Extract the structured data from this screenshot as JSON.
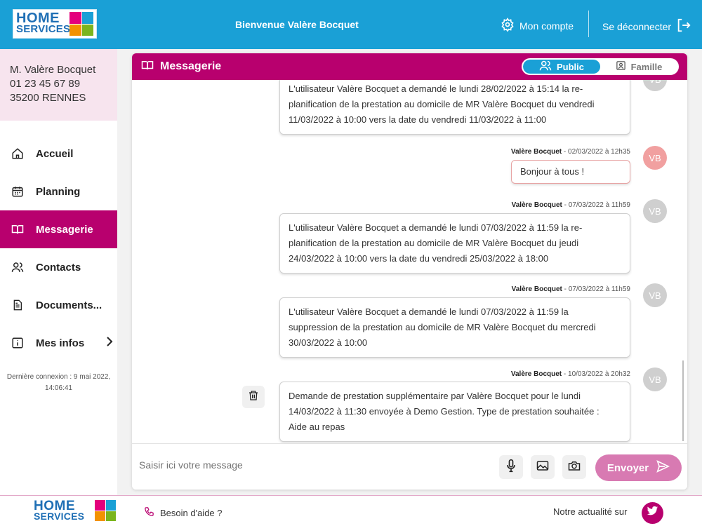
{
  "header": {
    "logo_line1": "HOME",
    "logo_line2": "SERVICES",
    "welcome": "Bienvenue Valère Bocquet",
    "account_label": "Mon compte",
    "logout_label": "Se déconnecter"
  },
  "sidebar": {
    "user": {
      "name": "M. Valère Bocquet",
      "phone": "01 23 45 67 89",
      "city": "35200 RENNES"
    },
    "items": [
      {
        "label": "Accueil",
        "icon": "home-icon"
      },
      {
        "label": "Planning",
        "icon": "calendar-icon"
      },
      {
        "label": "Messagerie",
        "icon": "book-open-icon",
        "active": true
      },
      {
        "label": "Contacts",
        "icon": "users-icon"
      },
      {
        "label": "Documents...",
        "icon": "document-icon"
      },
      {
        "label": "Mes infos",
        "icon": "info-icon"
      }
    ],
    "last_connection_line1": "Dernière connexion : 9 mai 2022,",
    "last_connection_line2": "14:06:41"
  },
  "panel": {
    "title": "Messagerie",
    "toggle": {
      "public_label": "Public",
      "family_label": "Famille",
      "selected": "Public"
    }
  },
  "messages": [
    {
      "author": "",
      "date": "",
      "avatar": "VB",
      "lines": [
        "L'utilisateur Valère Bocquet a demandé le lundi 28/02/2022 à 15:14 la re-",
        "planification de la prestation au domicile de MR Valère Bocquet du vendredi",
        "11/03/2022 à 10:00 vers la date du vendredi 11/03/2022 à 11:00"
      ]
    },
    {
      "author": "Valère Bocquet",
      "date": " - 02/03/2022 à 12h35",
      "avatar": "VB",
      "lines": [
        "Bonjour à tous !"
      ]
    },
    {
      "author": "Valère Bocquet",
      "date": " - 07/03/2022 à 11h59",
      "avatar": "VB",
      "lines": [
        "L'utilisateur Valère Bocquet a demandé le lundi 07/03/2022 à 11:59 la re-",
        "planification de la prestation au domicile de MR Valère Bocquet du jeudi",
        "24/03/2022 à 10:00 vers la date du vendredi 25/03/2022 à 18:00"
      ]
    },
    {
      "author": "Valère Bocquet",
      "date": " - 07/03/2022 à 11h59",
      "avatar": "VB",
      "lines": [
        "L'utilisateur Valère Bocquet a demandé le lundi 07/03/2022 à 11:59 la",
        "suppression de la prestation au domicile de MR Valère Bocquet du mercredi",
        "30/03/2022 à 10:00"
      ]
    },
    {
      "author": "Valère Bocquet",
      "date": " - 10/03/2022 à 20h32",
      "avatar": "VB",
      "lines": [
        "Demande de prestation supplémentaire par Valère Bocquet pour le lundi",
        "14/03/2022 à 11:30 envoyée à Demo Gestion. Type de prestation souhaitée :",
        "Aide au repas"
      ]
    }
  ],
  "composer": {
    "placeholder": "Saisir ici votre message",
    "send_label": "Envoyer"
  },
  "footer": {
    "logo_line1": "HOME",
    "logo_line2": "SERVICES",
    "help_label": "Besoin d'aide ?",
    "news_label": "Notre actualité sur"
  },
  "colors": {
    "header_blue": "#1aa0d6",
    "brand_magenta": "#b8006e",
    "send_pink": "#d87ab2",
    "logo_blue": "#1f6fb5",
    "logo_squares": [
      "#e4007c",
      "#1aa0d6",
      "#f39200",
      "#7ab51d"
    ]
  }
}
